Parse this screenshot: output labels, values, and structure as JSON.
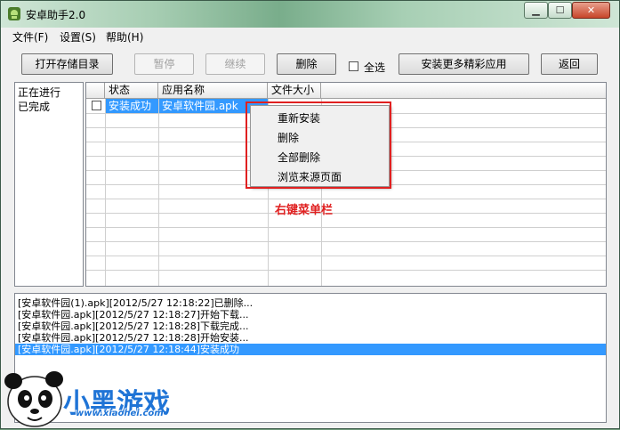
{
  "window": {
    "title": "安卓助手2.0"
  },
  "menu": {
    "items": [
      "文件(F)",
      "设置(S)",
      "帮助(H)"
    ]
  },
  "toolbar": {
    "open_dir": "打开存储目录",
    "pause": "暂停",
    "resume": "继续",
    "delete": "删除",
    "select_all": "全选",
    "install_more": "安装更多精彩应用",
    "back": "返回"
  },
  "left_panel": {
    "items": [
      "正在进行",
      "已完成"
    ]
  },
  "table": {
    "headers": [
      "状态",
      "应用名称",
      "文件大小"
    ],
    "rows": [
      {
        "checked": false,
        "status": "安装成功",
        "name": "安卓软件园.apk",
        "size": ""
      }
    ]
  },
  "context_menu": {
    "items": [
      "重新安装",
      "删除",
      "全部删除",
      "浏览来源页面"
    ]
  },
  "annotation": {
    "label": "右键菜单栏"
  },
  "log": {
    "lines": [
      "[安卓软件园(1).apk][2012/5/27 12:18:22]已删除...",
      "[安卓软件园.apk][2012/5/27 12:18:27]开始下载...",
      "[安卓软件园.apk][2012/5/27 12:18:28]下载完成...",
      "[安卓软件园.apk][2012/5/27 12:18:28]开始安装...",
      "[安卓软件园.apk][2012/5/27 12:18:44]安装成功"
    ],
    "selected_index": 4
  },
  "watermark": {
    "title": "小黑游戏",
    "url": "www.xiaohei.com"
  },
  "colors": {
    "selection": "#3399ff",
    "annotation_red": "#e02020",
    "logo_blue": "#1f74d6"
  }
}
